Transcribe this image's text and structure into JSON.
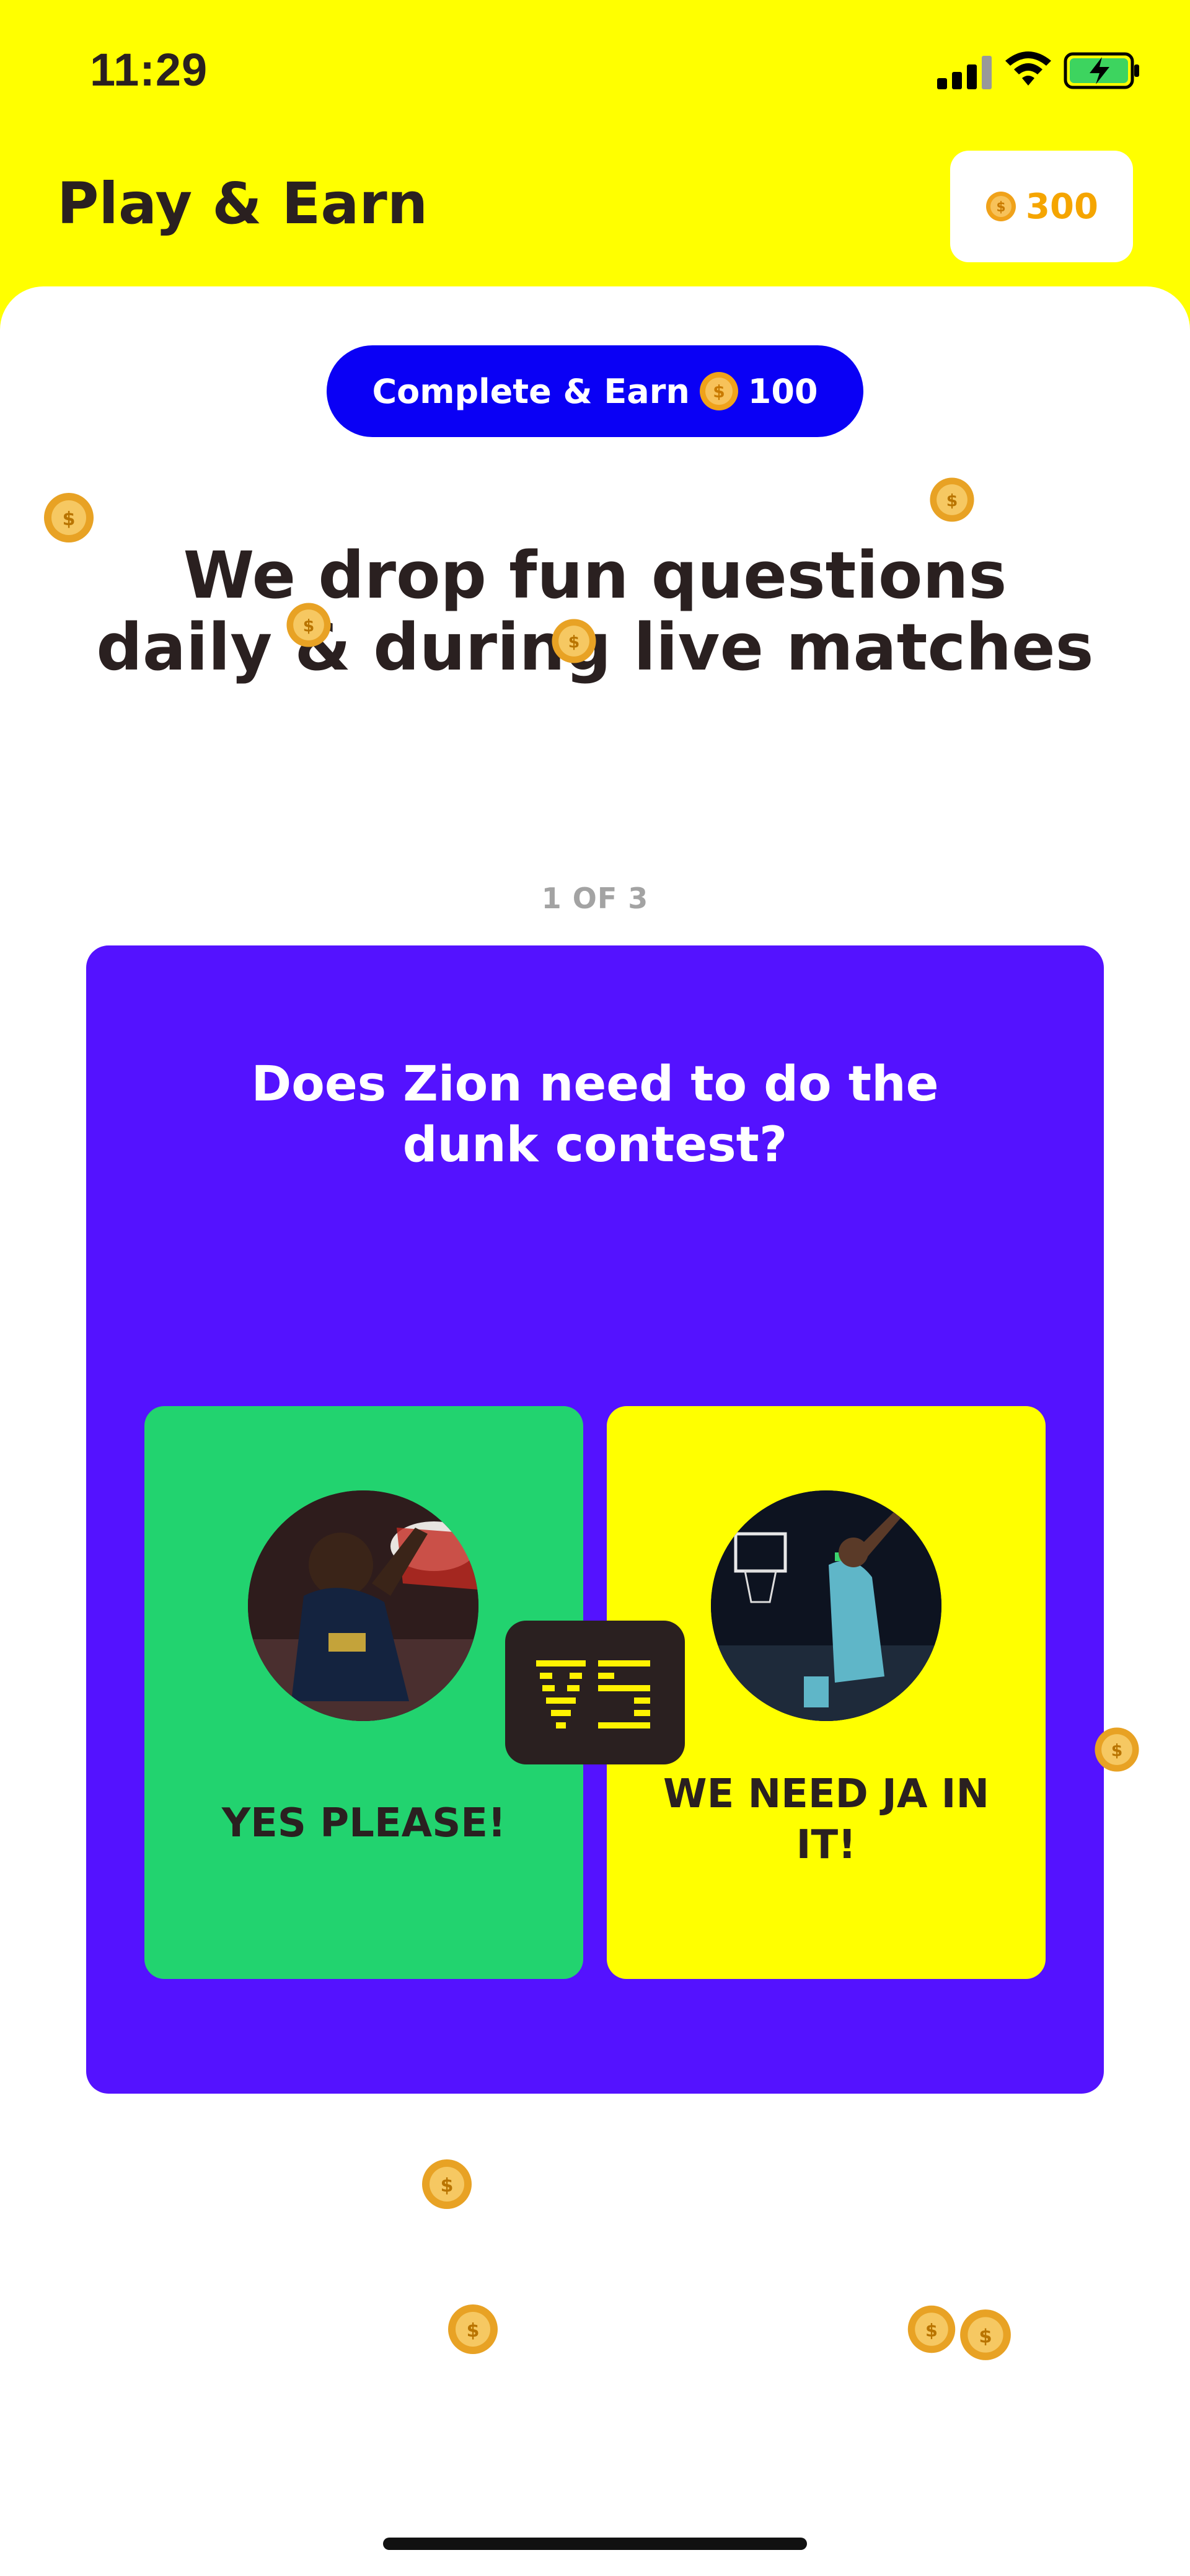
{
  "status_bar": {
    "time": "11:29"
  },
  "header": {
    "title": "Play & Earn",
    "coin_balance": "300"
  },
  "earn_pill": {
    "label": "Complete & Earn",
    "amount": "100"
  },
  "headline": {
    "line1": "We drop fun questions",
    "line2": "daily & during live matches"
  },
  "pager": {
    "label": "1 OF 3"
  },
  "question_card": {
    "question_line1": "Does Zion need to do the",
    "question_line2": "dunk contest?",
    "option_yes": {
      "label": "YES PLEASE!"
    },
    "option_ja": {
      "label_line1": "WE NEED JA IN",
      "label_line2": "IT!"
    },
    "vs_label": "VS"
  },
  "colors": {
    "brand_yellow": "#FFFF00",
    "pill_blue": "#0A00F5",
    "card_purple": "#5412FF",
    "option_green": "#22D36F",
    "coin_gold": "#F5A500"
  }
}
